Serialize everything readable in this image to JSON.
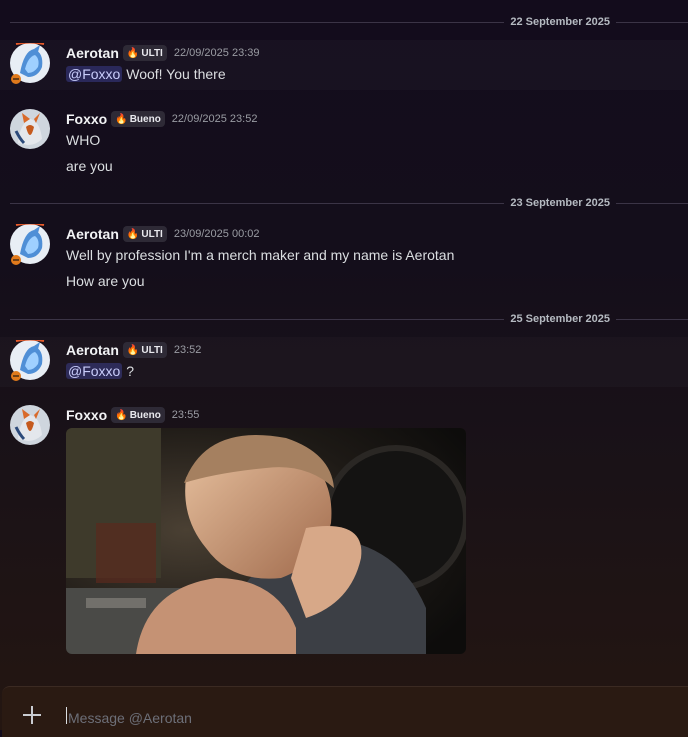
{
  "dividers": [
    "22 September 2025",
    "23 September 2025",
    "25 September 2025"
  ],
  "messages": [
    {
      "username": "Aerotan",
      "tag": "ULTI",
      "timestamp": "22/09/2025 23:39",
      "mention": "@Foxxo",
      "text": "Woof! You there",
      "avatar": "aerotan-avatar"
    },
    {
      "username": "Foxxo",
      "tag": "Bueno",
      "timestamp": "22/09/2025 23:52",
      "lines": [
        "WHO",
        "are you"
      ],
      "avatar": "foxxo-avatar"
    },
    {
      "username": "Aerotan",
      "tag": "ULTI",
      "timestamp": "23/09/2025 00:02",
      "lines": [
        "Well by profession I'm a merch maker and my name is Aerotan",
        "How are you"
      ],
      "avatar": "aerotan-avatar"
    },
    {
      "username": "Aerotan",
      "tag": "ULTI",
      "timestamp": "23:52",
      "mention": "@Foxxo",
      "text": "?",
      "avatar": "aerotan-avatar"
    },
    {
      "username": "Foxxo",
      "tag": "Bueno",
      "timestamp": "23:55",
      "attachment": "gif-image",
      "avatar": "foxxo-avatar"
    }
  ],
  "composer": {
    "placeholder": "Message @Aerotan",
    "value": ""
  },
  "colors": {
    "mention_bg": "#3b3a6e",
    "username": "#f2f3f5",
    "timestamp": "#9a9ca3",
    "ulti_fire": "#ff6a3a",
    "bueno_fire": "#ffa12a"
  }
}
